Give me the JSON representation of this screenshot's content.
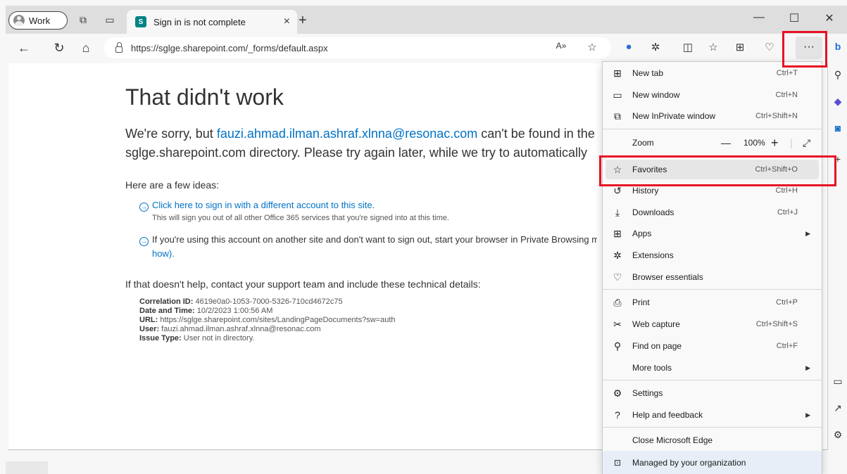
{
  "titlebar": {
    "profile_label": "Work",
    "tab_title": "Sign in is not complete",
    "tab_close": "×",
    "new_tab": "+",
    "minimize": "—",
    "maximize": "☐",
    "close": "✕"
  },
  "toolbar": {
    "url": "https://sglge.sharepoint.com/_forms/default.aspx",
    "more_label": "···"
  },
  "page": {
    "title": "That didn't work",
    "msg_pre": "We're sorry, but ",
    "email": "fauzi.ahmad.ilman.ashraf.xlnna@resonac.com",
    "msg_post": " can't be found in the",
    "msg_line2": "sglge.sharepoint.com directory. Please try again later, while we try to automatically",
    "ideas_heading": "Here are a few ideas:",
    "idea1_link": "Click here to sign in with a different account to this site.",
    "idea1_sub": "This will sign you out of all other Office 365 services that you're signed into at this time.",
    "idea2_text": "If you're using this account on another site and don't want to sign out, start your browser in Private Browsing mod",
    "idea2_link": "how).",
    "help_text": "If that doesn't help, contact your support team and include these technical details:",
    "details": [
      {
        "label": "Correlation ID:",
        "value": " 4619e0a0-1053-7000-5326-710cd4672c75"
      },
      {
        "label": "Date and Time:",
        "value": " 10/2/2023 1:00:56 AM"
      },
      {
        "label": "URL:",
        "value": " https://sglge.sharepoint.com/sites/LandingPageDocuments?sw=auth"
      },
      {
        "label": "User:",
        "value": " fauzi.ahmad.ilman.ashraf.xlnna@resonac.com"
      },
      {
        "label": "Issue Type:",
        "value": " User not in directory."
      }
    ]
  },
  "menu": {
    "new_tab": {
      "label": "New tab",
      "shortcut": "Ctrl+T"
    },
    "new_window": {
      "label": "New window",
      "shortcut": "Ctrl+N"
    },
    "new_inprivate": {
      "label": "New InPrivate window",
      "shortcut": "Ctrl+Shift+N"
    },
    "zoom": {
      "label": "Zoom",
      "minus": "—",
      "value": "100%",
      "plus": "+"
    },
    "favorites": {
      "label": "Favorites",
      "shortcut": "Ctrl+Shift+O"
    },
    "history": {
      "label": "History",
      "shortcut": "Ctrl+H"
    },
    "downloads": {
      "label": "Downloads",
      "shortcut": "Ctrl+J"
    },
    "apps": {
      "label": "Apps"
    },
    "extensions": {
      "label": "Extensions"
    },
    "browser_essentials": {
      "label": "Browser essentials"
    },
    "print": {
      "label": "Print",
      "shortcut": "Ctrl+P"
    },
    "web_capture": {
      "label": "Web capture",
      "shortcut": "Ctrl+Shift+S"
    },
    "find_on_page": {
      "label": "Find on page",
      "shortcut": "Ctrl+F"
    },
    "more_tools": {
      "label": "More tools"
    },
    "settings": {
      "label": "Settings"
    },
    "help_feedback": {
      "label": "Help and feedback"
    },
    "close_edge": {
      "label": "Close Microsoft Edge"
    },
    "managed": {
      "label": "Managed by your organization"
    }
  }
}
